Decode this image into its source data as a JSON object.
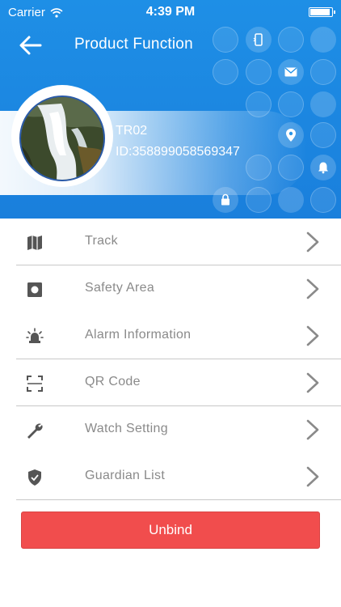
{
  "status_bar": {
    "carrier": "Carrier",
    "time": "4:39 PM"
  },
  "nav": {
    "title": "Product Function",
    "back_icon": "arrow-left-icon"
  },
  "device": {
    "name": "TR02",
    "id": "ID:358899058569347"
  },
  "menu": {
    "items": [
      {
        "label": "Track",
        "icon": "map-icon"
      },
      {
        "label": "Safety Area",
        "icon": "safety-area-icon"
      },
      {
        "label": "Alarm Information",
        "icon": "alarm-light-icon"
      },
      {
        "label": "QR Code",
        "icon": "qr-scan-icon"
      },
      {
        "label": "Watch Setting",
        "icon": "wrench-icon"
      },
      {
        "label": "Guardian List",
        "icon": "shield-icon"
      }
    ]
  },
  "unbind_label": "Unbind",
  "colors": {
    "header_blue": "#1e8fe6",
    "unbind_red": "#f14d4d",
    "label_gray": "#8a8a8a"
  }
}
